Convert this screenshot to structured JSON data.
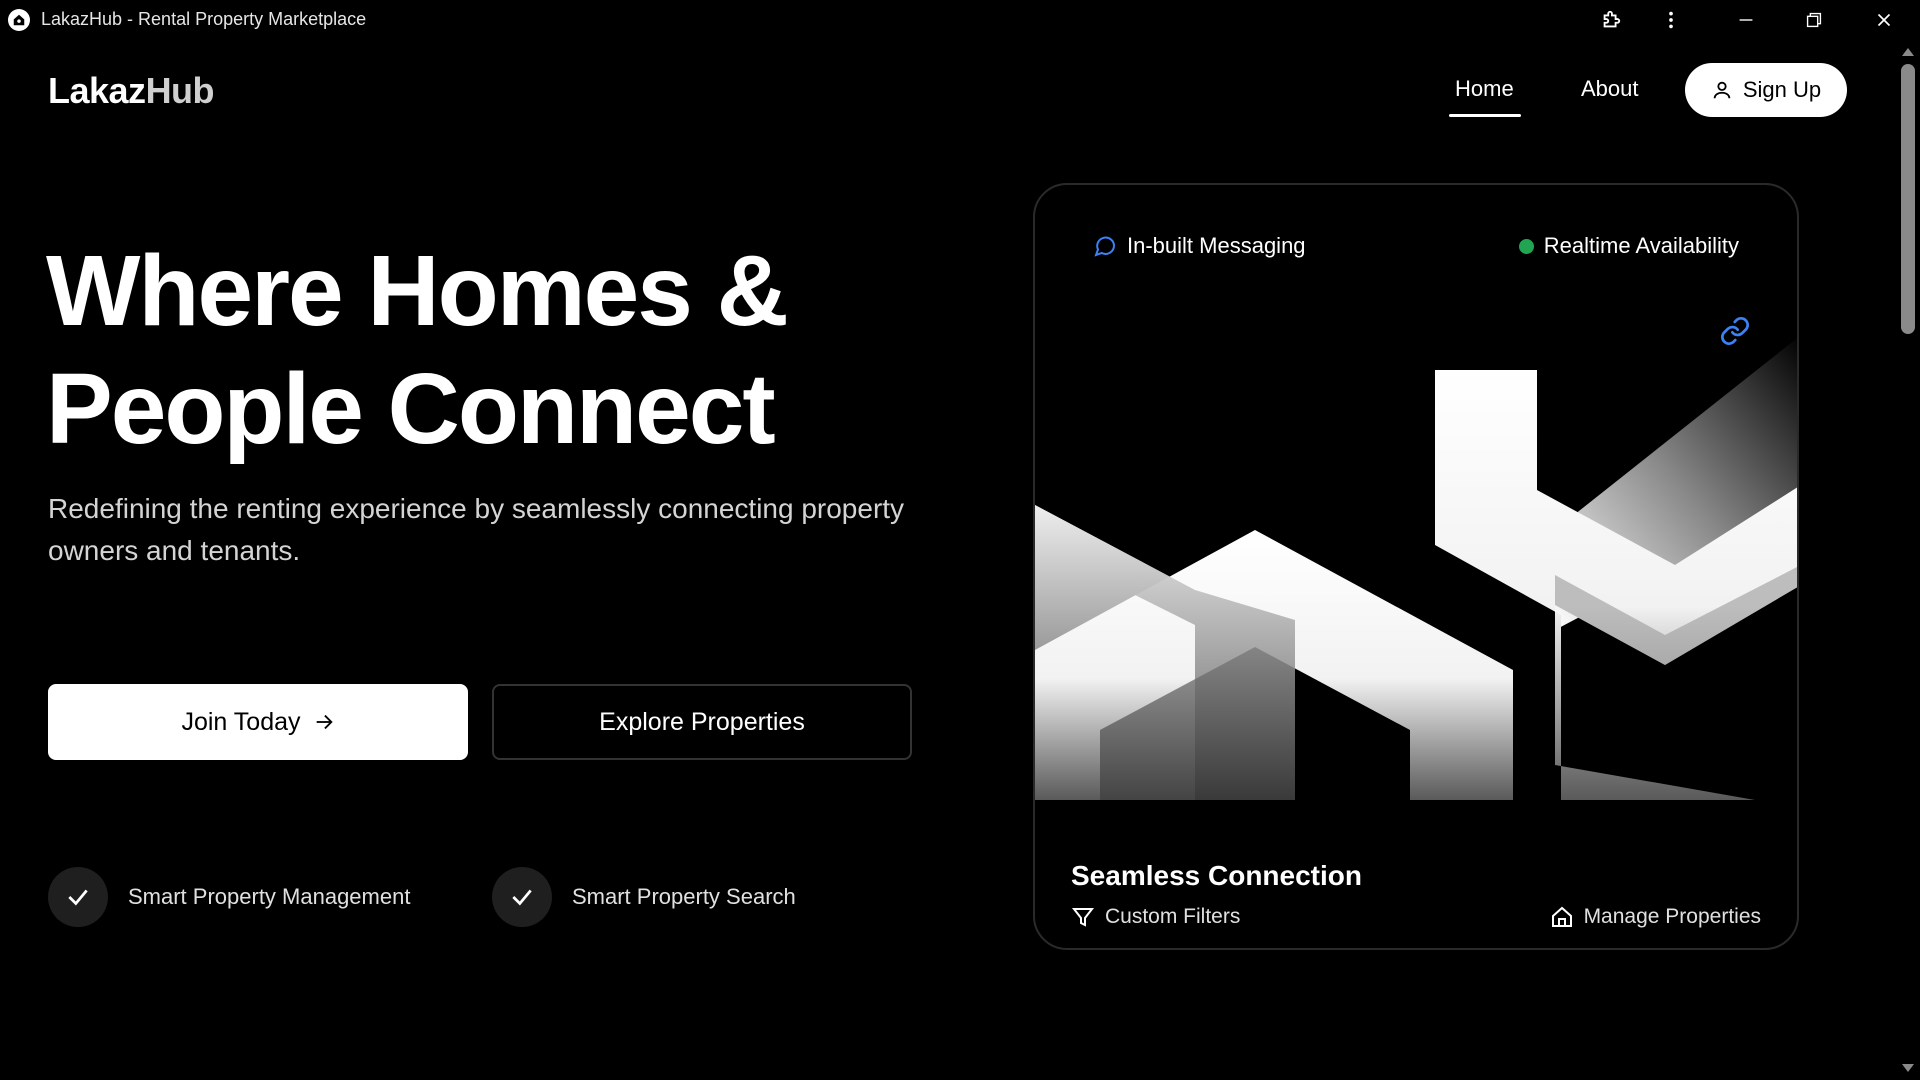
{
  "window": {
    "title": "LakazHub - Rental Property Marketplace",
    "controls": [
      "extensions-icon",
      "more-icon",
      "minimize-icon",
      "restore-icon",
      "close-icon"
    ]
  },
  "header": {
    "logo_part1": "Lakaz",
    "logo_part2": "Hub",
    "nav": {
      "home": "Home",
      "about": "About",
      "active": "Home"
    },
    "signup_label": "Sign Up"
  },
  "hero": {
    "title_line1": "Where Homes &",
    "title_line2": "People Connect",
    "subtitle": "Redefining the renting experience by seamlessly connecting property owners and tenants.",
    "join_label": "Join Today",
    "explore_label": "Explore Properties",
    "features": [
      "Smart Property Management",
      "Smart Property Search"
    ]
  },
  "card": {
    "messaging_label": "In-built Messaging",
    "availability_label": "Realtime Availability",
    "title": "Seamless Connection",
    "filters_label": "Custom Filters",
    "manage_label": "Manage Properties",
    "colors": {
      "availability_dot": "#22a552",
      "messaging_icon": "#3b82f6",
      "link_icon": "#3b82f6"
    }
  }
}
